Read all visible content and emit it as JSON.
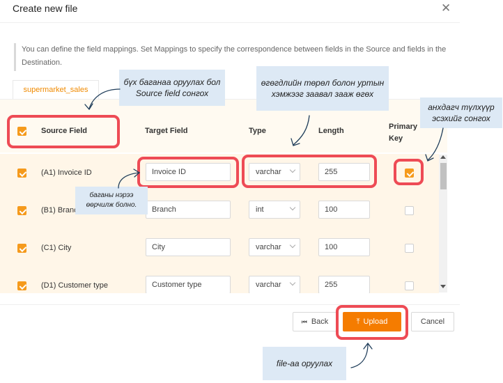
{
  "dialog": {
    "title": "Create new file",
    "info": "You can define the field mappings. Set Mappings to specify the correspondence between fields in the Source and fields in the Destination."
  },
  "tab": {
    "label": "supermarket_sales"
  },
  "table": {
    "headers": {
      "source": "Source Field",
      "target": "Target Field",
      "type": "Type",
      "length": "Length",
      "primary": "Primary Key"
    },
    "rows": [
      {
        "source": "(A1) Invoice ID",
        "target": "Invoice ID",
        "type": "varchar",
        "length": "255",
        "checked": true,
        "primary": true
      },
      {
        "source": "(B1) Branch",
        "target": "Branch",
        "type": "int",
        "length": "100",
        "checked": true,
        "primary": false
      },
      {
        "source": "(C1) City",
        "target": "City",
        "type": "varchar",
        "length": "100",
        "checked": true,
        "primary": false
      },
      {
        "source": "(D1) Customer type",
        "target": "Customer type",
        "type": "varchar",
        "length": "255",
        "checked": true,
        "primary": false
      }
    ]
  },
  "footer": {
    "back": "Back",
    "upload": "Upload",
    "cancel": "Cancel"
  },
  "annotations": {
    "select_all": "бүх баганаа оруулах бол Source field сонгох",
    "type_length": "өгөгдлийн төрөл болон уртын хэмжээг заавал зааж өгөх",
    "primary_key": "анхдагч түлхүүр эсэхийг сонгох",
    "rename_column": "баганы нэрээ өөрчилж болно.",
    "upload_file": "file-aa оруулах"
  },
  "colors": {
    "accent": "#f57c00",
    "highlight": "#ee4b55",
    "callout_bg": "#dde9f5"
  },
  "icons": {
    "close": "close-icon",
    "back": "skip-back-icon",
    "upload": "upload-icon",
    "dropdown": "chevron-down-icon"
  }
}
